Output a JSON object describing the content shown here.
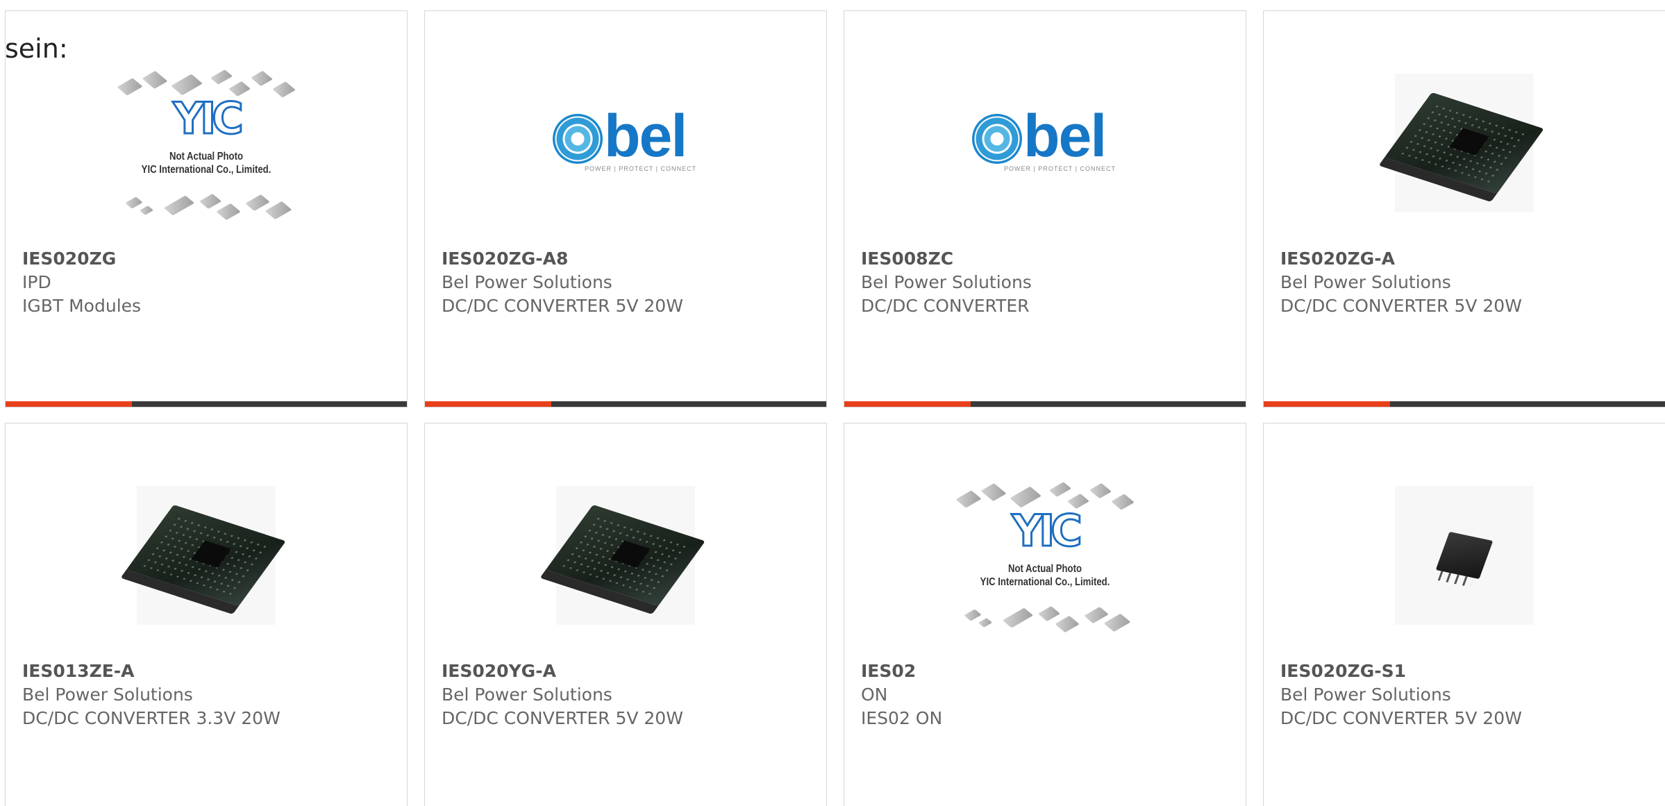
{
  "intro_text": "sein:",
  "image_placeholder": {
    "line1": "Not Actual Photo",
    "line2": "YIC International Co., Limited."
  },
  "brand_logo": {
    "tagline": "POWER | PROTECT | CONNECT"
  },
  "colors": {
    "accent": "#e8401c",
    "bar": "#3a3a3a",
    "brand_blue": "#1677c6",
    "text": "#666666"
  },
  "products": [
    {
      "part": "IES020ZG",
      "brand": "IPD",
      "description": "IGBT Modules",
      "image": "yic-placeholder"
    },
    {
      "part": "IES020ZG-A8",
      "brand": "Bel Power Solutions",
      "description": "DC/DC CONVERTER 5V 20W",
      "image": "bel-logo"
    },
    {
      "part": "IES008ZC",
      "brand": "Bel Power Solutions",
      "description": "DC/DC CONVERTER",
      "image": "bel-logo"
    },
    {
      "part": "IES020ZG-A",
      "brand": "Bel Power Solutions",
      "description": "DC/DC CONVERTER 5V 20W",
      "image": "pcb-board"
    },
    {
      "part": "IES013ZE-A",
      "brand": "Bel Power Solutions",
      "description": "DC/DC CONVERTER 3.3V 20W",
      "image": "pcb-board"
    },
    {
      "part": "IES020YG-A",
      "brand": "Bel Power Solutions",
      "description": "DC/DC CONVERTER 5V 20W",
      "image": "pcb-board"
    },
    {
      "part": "IES02",
      "brand": "ON",
      "description": "IES02 ON",
      "image": "yic-placeholder"
    },
    {
      "part": "IES020ZG-S1",
      "brand": "Bel Power Solutions",
      "description": "DC/DC CONVERTER 5V 20W",
      "image": "module"
    }
  ]
}
